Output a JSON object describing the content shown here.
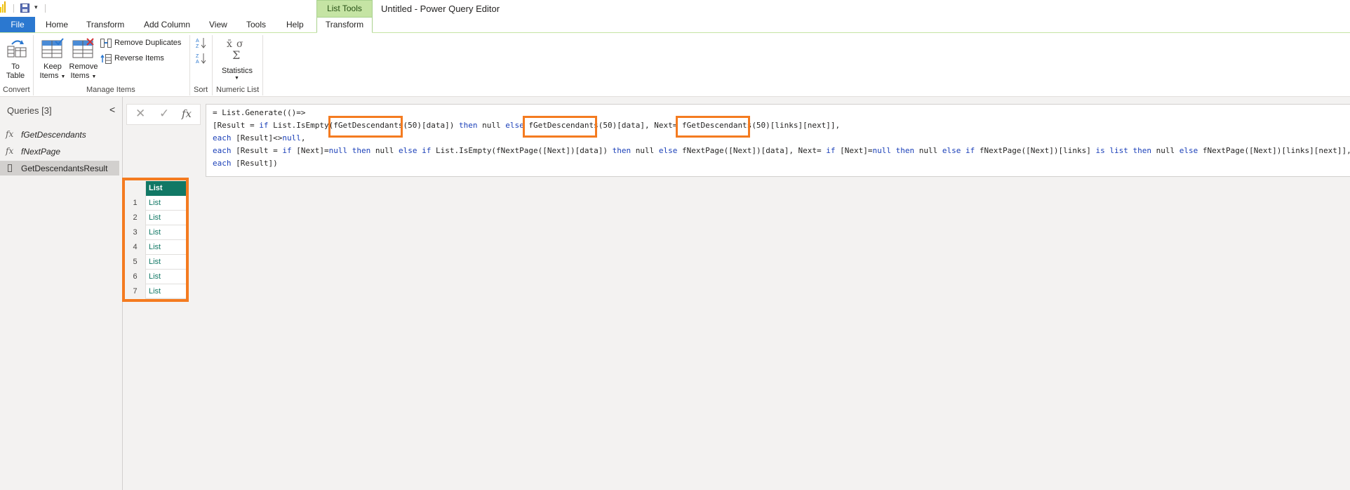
{
  "app": {
    "window_title": "Untitled - Power Query Editor",
    "contextual_tab_group": "List Tools"
  },
  "tabs": {
    "file": "File",
    "home": "Home",
    "transform": "Transform",
    "add_column": "Add Column",
    "view": "View",
    "tools": "Tools",
    "help": "Help",
    "active_contextual": "Transform"
  },
  "ribbon": {
    "convert": {
      "to_table_line1": "To",
      "to_table_line2": "Table",
      "group_label": "Convert"
    },
    "manage_items": {
      "keep_items_line1": "Keep",
      "keep_items_line2": "Items",
      "remove_items_line1": "Remove",
      "remove_items_line2": "Items",
      "remove_duplicates": "Remove Duplicates",
      "reverse_items": "Reverse Items",
      "group_label": "Manage Items"
    },
    "sort": {
      "group_label": "Sort"
    },
    "numeric_list": {
      "statistics": "Statistics",
      "group_label": "Numeric List"
    }
  },
  "queries_pane": {
    "title": "Queries [3]",
    "items": [
      {
        "name": "fGetDescendants",
        "type": "function"
      },
      {
        "name": "fNextPage",
        "type": "function"
      },
      {
        "name": "GetDescendantsResult",
        "type": "table",
        "selected": true
      }
    ]
  },
  "formula": {
    "line1": "= List.Generate(()=>",
    "line2": {
      "a": "[Result = ",
      "if1": "if",
      "b": " List.IsEmpty(",
      "fn1": "fGetDescendants",
      "c": "(50)[data]) ",
      "then1": "then",
      "null1": " null ",
      "else1": "else",
      "d": " ",
      "fn2": "fGetDescendants",
      "e": "(50)[data], Next= ",
      "fn3": "fGetDescendants",
      "f": "(50)[links][next]],"
    },
    "line3": {
      "each": "each",
      "rest": " [Result]<>",
      "null": "null",
      "tail": ","
    },
    "line4": {
      "each": "each",
      "a": " [Result = ",
      "if1": "if",
      "b": " [Next]=",
      "null1": "null",
      "sp1": " ",
      "then1": "then",
      "null2": " null ",
      "else1": "else",
      "sp2": " ",
      "if2": "if",
      "c": " List.IsEmpty(fNextPage([Next])[data]) ",
      "then2": "then",
      "null3": " null ",
      "else2": "else",
      "d": " fNextPage([Next])[data], Next= ",
      "if3": "if",
      "e": " [Next]=",
      "null4": "null",
      "sp3": " ",
      "then3": "then",
      "null5": " null ",
      "else3": "else",
      "sp4": " ",
      "if4": "if",
      "f": " fNextPage([Next])[links] ",
      "is": "is",
      "g": " ",
      "list": "list",
      "h": " ",
      "then4": "then",
      "null6": " null ",
      "else4": "else",
      "i": " fNextPage([Next])[links][next]],"
    },
    "line5": {
      "each": "each",
      "rest": " [Result])"
    }
  },
  "grid": {
    "column_header": "List",
    "rows": [
      {
        "num": "1",
        "value": "List"
      },
      {
        "num": "2",
        "value": "List"
      },
      {
        "num": "3",
        "value": "List"
      },
      {
        "num": "4",
        "value": "List"
      },
      {
        "num": "5",
        "value": "List"
      },
      {
        "num": "6",
        "value": "List"
      },
      {
        "num": "7",
        "value": "List"
      }
    ]
  },
  "colors": {
    "highlight": "#f47b20",
    "file_tab": "#2b78d0",
    "contextual_green": "#c5e4a4",
    "grid_header": "#117865",
    "keyword_blue": "#1a3fb8"
  }
}
